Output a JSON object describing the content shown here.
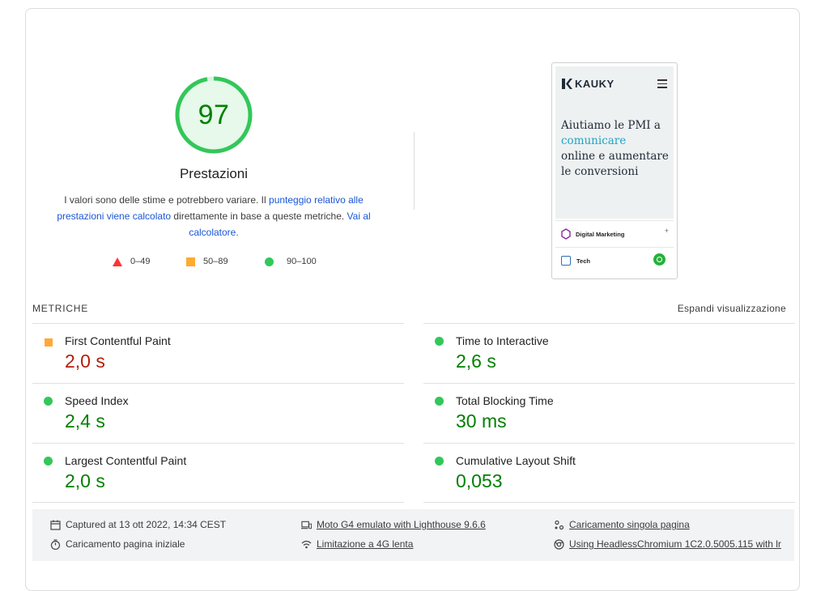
{
  "category": {
    "score": "97",
    "score_fraction": 0.97,
    "title": "Prestazioni",
    "desc_part1": "I valori sono delle stime e potrebbero variare. Il ",
    "desc_link1": "punteggio relativo alle prestazioni viene calcolato",
    "desc_part2": " direttamente in base a queste metriche. ",
    "desc_link2": "Vai al calcolatore."
  },
  "legend": {
    "fail": "0–49",
    "average": "50–89",
    "pass": "90–100"
  },
  "screenshot": {
    "logo": "KAUKY",
    "hero_line1": "Aiutiamo le PMI a",
    "hero_accent": "comunicare",
    "hero_line2": "online e aumentare le conversioni",
    "row1": "Digital Marketing",
    "row1_plus": "+",
    "row2": "Tech"
  },
  "metrics": {
    "section_label": "METRICHE",
    "expand_label": "Espandi visualizzazione",
    "items": [
      {
        "name": "First Contentful Paint",
        "value": "2,0 s",
        "status": "average"
      },
      {
        "name": "Time to Interactive",
        "value": "2,6 s",
        "status": "pass"
      },
      {
        "name": "Speed Index",
        "value": "2,4 s",
        "status": "pass"
      },
      {
        "name": "Total Blocking Time",
        "value": "30 ms",
        "status": "pass"
      },
      {
        "name": "Largest Contentful Paint",
        "value": "2,0 s",
        "status": "pass"
      },
      {
        "name": "Cumulative Layout Shift",
        "value": "0,053",
        "status": "pass"
      }
    ]
  },
  "footer": {
    "captured": "Captured at 13 ott 2022, 14:34 CEST",
    "initial_load": "Caricamento pagina iniziale",
    "device": "Moto G4 emulato with Lighthouse 9.6.6",
    "throttling": "Limitazione a 4G lenta",
    "single_load": "Caricamento singola pagina",
    "browser": "Using HeadlessChromium 1C2.0.5005.115 with lr"
  },
  "colors": {
    "pass": "#33c75a",
    "average": "#ffaa33",
    "fail": "#ff3333",
    "pass_text": "#008000",
    "average_text": "#b41e0a",
    "link": "#1a56d6"
  }
}
